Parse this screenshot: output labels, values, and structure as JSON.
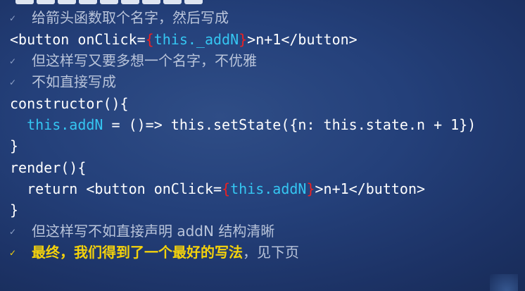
{
  "bullets": {
    "b1": "给箭头函数取个名字，然后写成",
    "b2": "但这样写又要多想一个名字，不优雅",
    "b3": "不如直接写成",
    "b4": "但这样写不如直接声明 addN 结构清晰",
    "b5_main": "最终，我们得到了一个最好的写法",
    "b5_tail": "，见下页"
  },
  "code": {
    "l1_a": "<button onClick=",
    "l1_brace_open": "{",
    "l1_expr": "this._addN",
    "l1_brace_close": "}",
    "l1_b": ">n+1</button>",
    "l2": "constructor(){",
    "l3_indent": "  ",
    "l3_expr": "this.addN",
    "l3_rest": " = ()=> this.setState({n: this.state.n + 1})",
    "l4": "}",
    "l5": "render(){",
    "l6_a": "  return <button onClick=",
    "l6_brace_open": "{",
    "l6_expr": "this.addN",
    "l6_brace_close": "}",
    "l6_b": ">n+1</button>",
    "l7": "}"
  },
  "icons": {
    "bullet": "checkmark-icon"
  },
  "colors": {
    "background": "#24407a",
    "code_text": "#ffffff",
    "keyword_cyan": "#35c6f2",
    "brace_red": "#ef2020",
    "bullet_text": "#b9c4da",
    "highlight_yellow": "#f5d20b"
  }
}
